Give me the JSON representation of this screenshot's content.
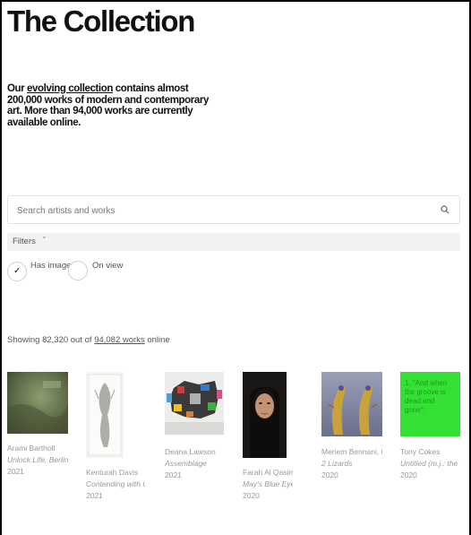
{
  "page": {
    "title": "The Collection",
    "intro_pre": "Our ",
    "intro_link": "evolving collection",
    "intro_post": " contains almost 200,000 works of modern and contemporary art. More than 94,000 works are currently available online."
  },
  "search": {
    "placeholder": "Search artists and works"
  },
  "filters": {
    "label": "Filters",
    "has_image_label": "Has image",
    "has_image_checked": true,
    "on_view_label": "On view",
    "on_view_checked": false
  },
  "results": {
    "showing_pre": "Showing 82,320 out of ",
    "showing_link": "94,082 works",
    "showing_post": " online"
  },
  "artworks": [
    {
      "artist": "Arami Bartholl",
      "title": "Unlock Life, Berlin, (",
      "year": "2021"
    },
    {
      "artist": "Kenturah Davis",
      "title": "Contending with Co",
      "year": "2021"
    },
    {
      "artist": "Deana Lawson",
      "title": "Assemblage",
      "year": "2021"
    },
    {
      "artist": "Farah Al Qasimi",
      "title": "May's Blue Eye",
      "year": "2020"
    },
    {
      "artist": "Meriem Bennani, O",
      "title": "2 Lizards",
      "year": "2020"
    },
    {
      "artist": "Tony Cokes",
      "title": "Untitled (m.j.: the s",
      "year": "2020",
      "image_text": "1. \"And when the groove is dead and gone\":"
    }
  ],
  "colors": {
    "green_card": "#33e033",
    "green_text": "#1f9a1f"
  }
}
